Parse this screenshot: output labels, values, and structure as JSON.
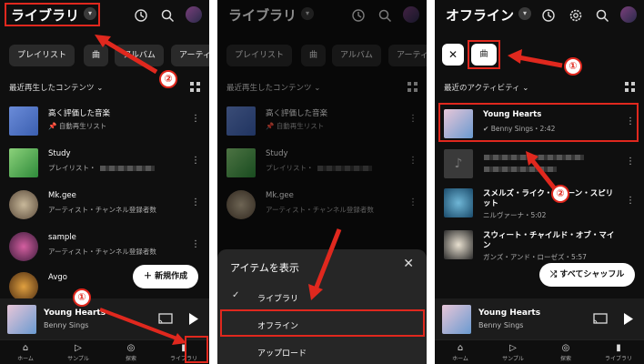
{
  "panel1": {
    "title": "ライブラリ",
    "chips": [
      "プレイリスト",
      "曲",
      "アルバム",
      "アーティ"
    ],
    "section": "最近再生したコンテンツ",
    "rows": [
      {
        "title": "高く評価した音楽",
        "subtitle": "自動再生リスト"
      },
      {
        "title": "Study",
        "subtitle": "プレイリスト・"
      },
      {
        "title": "Mk.gee",
        "subtitle": "アーティスト・チャンネル登録者数"
      },
      {
        "title": "sample",
        "subtitle": "アーティスト・チャンネル登録者数"
      },
      {
        "title": "Avgo",
        "subtitle": ""
      }
    ],
    "new_button": "新規作成",
    "nav": [
      "ホーム",
      "サンプル",
      "探索",
      "ライブラリ"
    ]
  },
  "panel2": {
    "title": "ライブラリ",
    "chips": [
      "プレイリスト",
      "曲",
      "アルバム",
      "アーティ"
    ],
    "section": "最近再生したコンテンツ",
    "rows": [
      {
        "title": "高く評価した音楽",
        "subtitle": "自動再生リスト"
      },
      {
        "title": "Study",
        "subtitle": "プレイリスト・"
      },
      {
        "title": "Mk.gee",
        "subtitle": "アーティスト・チャンネル登録者数"
      }
    ],
    "sheet_title": "アイテムを表示",
    "sheet_items": [
      "ライブラリ",
      "オフライン",
      "アップロード"
    ]
  },
  "panel3": {
    "title": "オフライン",
    "chip_song": "曲",
    "section": "最近のアクティビティ",
    "rows": [
      {
        "title": "Young Hearts",
        "subtitle": "Benny Sings・2:42"
      },
      {
        "title": "",
        "subtitle": ""
      },
      {
        "title": "スメルズ・ライク・ティーン・スピリット",
        "subtitle": "ニルヴァーナ・5:02"
      },
      {
        "title": "スウィート・チャイルド・オブ・マイン",
        "subtitle": "ガンズ・アンド・ローゼズ・5:57"
      }
    ],
    "shuffle_button": "すべてシャッフル",
    "nav": [
      "ホーム",
      "サンプル",
      "探索",
      "ライブラリ"
    ]
  },
  "player": {
    "title": "Young Hearts",
    "artist": "Benny Sings"
  },
  "badges": {
    "one": "①",
    "two": "②"
  },
  "colors": {
    "accent": "#e0281e",
    "background": "#0f0f0f"
  }
}
